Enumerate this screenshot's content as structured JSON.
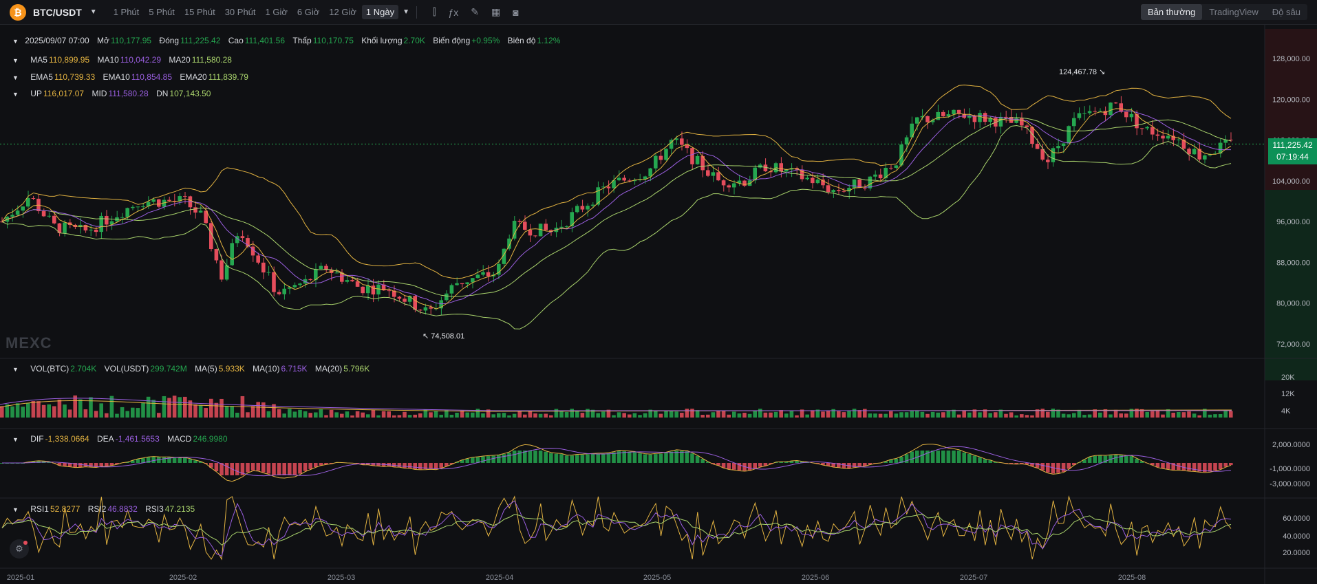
{
  "toolbar": {
    "logo_glyph": "₿",
    "pair": "BTC/USDT",
    "timeframes": [
      "1 Phút",
      "5 Phút",
      "15 Phút",
      "30 Phút",
      "1 Giờ",
      "6 Giờ",
      "12 Giờ",
      "1 Ngày"
    ],
    "active_timeframe": "1 Ngày",
    "tools": [
      "candle-style-icon",
      "indicator-icon",
      "pencil-icon",
      "layout-icon",
      "camera-icon"
    ],
    "view_tabs": [
      "Bản thường",
      "TradingView",
      "Độ sâu"
    ],
    "active_view": "Bản thường"
  },
  "ohlc": {
    "date": "2025/09/07 07:00",
    "open_label": "Mở",
    "open": "110,177.95",
    "close_label": "Đóng",
    "close": "111,225.42",
    "high_label": "Cao",
    "high": "111,401.56",
    "low_label": "Thấp",
    "low": "110,170.75",
    "volume_label": "Khối lượng",
    "volume": "2.70K",
    "change_label": "Biến động",
    "change": "+0.95%",
    "amplitude_label": "Biên độ",
    "amplitude": "1.12%"
  },
  "ma": {
    "ma5_label": "MA5",
    "ma5": "110,899.95",
    "ma10_label": "MA10",
    "ma10": "110,042.29",
    "ma20_label": "MA20",
    "ma20": "111,580.28"
  },
  "ema": {
    "ema5_label": "EMA5",
    "ema5": "110,739.33",
    "ema10_label": "EMA10",
    "ema10": "110,854.85",
    "ema20_label": "EMA20",
    "ema20": "111,839.79"
  },
  "boll": {
    "up_label": "UP",
    "up": "116,017.07",
    "mid_label": "MID",
    "mid": "111,580.28",
    "dn_label": "DN",
    "dn": "107,143.50"
  },
  "vol": {
    "vol_btc_label": "VOL(BTC)",
    "vol_btc": "2.704K",
    "vol_usdt_label": "VOL(USDT)",
    "vol_usdt": "299.742M",
    "ma5_label": "MA(5)",
    "ma5": "5.933K",
    "ma10_label": "MA(10)",
    "ma10": "6.715K",
    "ma20_label": "MA(20)",
    "ma20": "5.796K"
  },
  "macd": {
    "dif_label": "DIF",
    "dif": "-1,338.0664",
    "dea_label": "DEA",
    "dea": "-1,461.5653",
    "macd_label": "MACD",
    "macd": "246.9980"
  },
  "rsi": {
    "rsi1_label": "RSI1",
    "rsi1": "52.8277",
    "rsi2_label": "RSI2",
    "rsi2": "46.8832",
    "rsi3_label": "RSI3",
    "rsi3": "47.2135"
  },
  "price_tag": {
    "price": "111,225.42",
    "countdown": "07:19:44"
  },
  "extremes": {
    "high_label": "124,467.78",
    "low_label": "74,508.01"
  },
  "watermark": "MEXC",
  "axes": {
    "price_ticks": [
      "128,000.00",
      "120,000.00",
      "112,000.00",
      "104,000.00",
      "96,000.00",
      "88,000.00",
      "80,000.00",
      "72,000.00"
    ],
    "volume_ticks": [
      "20K",
      "12K",
      "4K"
    ],
    "macd_ticks": [
      "2,000.0000",
      "-1,000.0000",
      "-3,000.0000"
    ],
    "rsi_ticks": [
      "60.0000",
      "40.0000",
      "20.0000"
    ],
    "date_ticks": [
      "2025-01",
      "2025-02",
      "2025-03",
      "2025-04",
      "2025-05",
      "2025-06",
      "2025-07",
      "2025-08"
    ]
  },
  "colors": {
    "up": "#25a750",
    "down": "#e54d5c",
    "ma5": "#e3b341",
    "ma10": "#9a5fe0",
    "ma20": "#a9d36c",
    "boll": "#e3b341"
  },
  "chart_data": {
    "type": "line",
    "title": "BTC/USDT",
    "series": [
      {
        "name": "MA5",
        "x": [
          "2025-01",
          "2025-02",
          "2025-03",
          "2025-04",
          "2025-05",
          "2025-06",
          "2025-07",
          "2025-08",
          "2025-09"
        ],
        "values": [
          96000,
          101000,
          85000,
          82000,
          97000,
          105000,
          110000,
          118000,
          110900
        ]
      },
      {
        "name": "MA10",
        "x": [
          "2025-01",
          "2025-02",
          "2025-03",
          "2025-04",
          "2025-05",
          "2025-06",
          "2025-07",
          "2025-08",
          "2025-09"
        ],
        "values": [
          95000,
          100000,
          88000,
          83000,
          95000,
          104000,
          109000,
          117000,
          110042
        ]
      },
      {
        "name": "MA20",
        "x": [
          "2025-01",
          "2025-02",
          "2025-03",
          "2025-04",
          "2025-05",
          "2025-06",
          "2025-07",
          "2025-08",
          "2025-09"
        ],
        "values": [
          94000,
          99000,
          92000,
          84000,
          91000,
          104000,
          107000,
          116000,
          111580
        ]
      }
    ],
    "ylim": [
      68000,
      134000
    ],
    "grid": false
  }
}
